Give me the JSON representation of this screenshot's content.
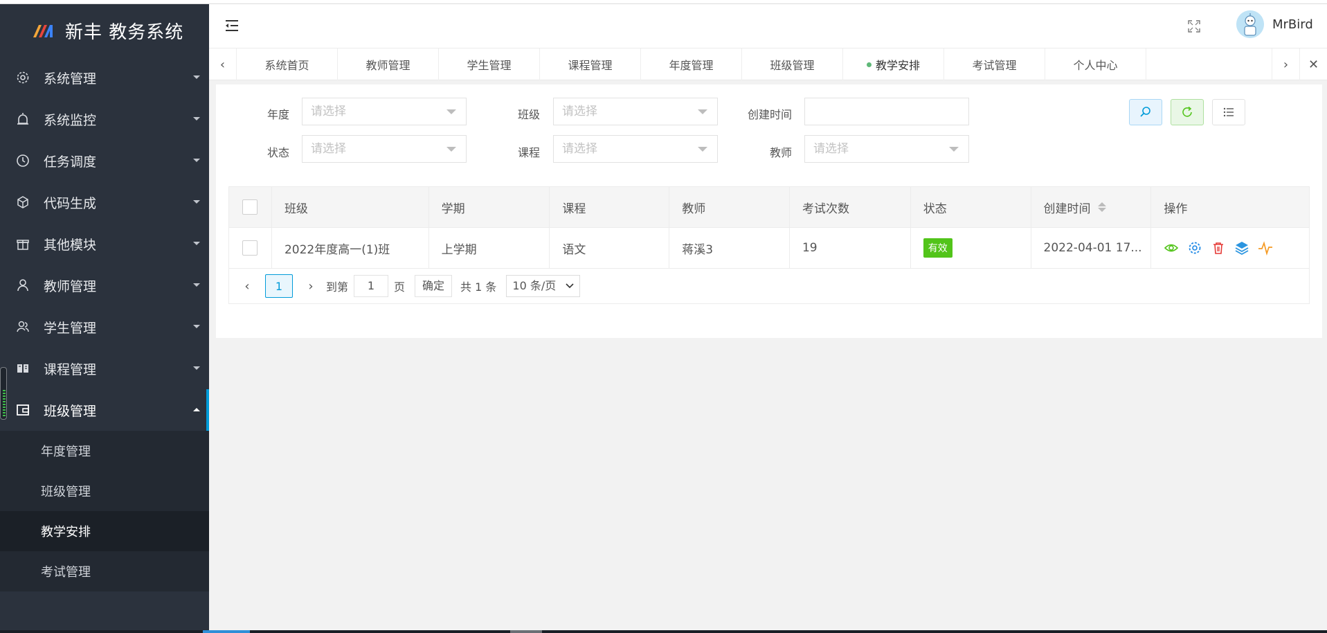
{
  "app": {
    "title": "新丰 教务系统",
    "username": "MrBird"
  },
  "colors": {
    "sidebar_bg": "#2b323d",
    "accent": "#009bd9",
    "status_ok": "#52c41a"
  },
  "sidebar": {
    "items": [
      {
        "label": "系统管理",
        "icon": "gear-icon"
      },
      {
        "label": "系统监控",
        "icon": "alarm-icon"
      },
      {
        "label": "任务调度",
        "icon": "clock-icon"
      },
      {
        "label": "代码生成",
        "icon": "cube-icon"
      },
      {
        "label": "其他模块",
        "icon": "gift-icon"
      },
      {
        "label": "教师管理",
        "icon": "user-icon"
      },
      {
        "label": "学生管理",
        "icon": "users-icon"
      },
      {
        "label": "课程管理",
        "icon": "book-icon"
      },
      {
        "label": "班级管理",
        "icon": "wallet-icon"
      }
    ],
    "subitems": [
      "年度管理",
      "班级管理",
      "教学安排",
      "考试管理"
    ],
    "active_subitem": "教学安排"
  },
  "tabs": [
    "系统首页",
    "教师管理",
    "学生管理",
    "课程管理",
    "年度管理",
    "班级管理",
    "教学安排",
    "考试管理",
    "个人中心"
  ],
  "active_tab": "教学安排",
  "filters": {
    "year_label": "年度",
    "class_label": "班级",
    "created_label": "创建时间",
    "status_label": "状态",
    "course_label": "课程",
    "teacher_label": "教师",
    "placeholder": "请选择"
  },
  "table": {
    "columns": [
      "班级",
      "学期",
      "课程",
      "教师",
      "考试次数",
      "状态",
      "创建时间",
      "操作"
    ],
    "rows": [
      {
        "class": "2022年度高一(1)班",
        "term": "上学期",
        "course": "语文",
        "teacher": "蒋溪3",
        "exams": "19",
        "status": "有效",
        "created": "2022-04-01 17..."
      }
    ]
  },
  "pager": {
    "current": "1",
    "goto_label": "到第",
    "goto_value": "1",
    "page_unit": "页",
    "confirm": "确定",
    "total": "共 1 条",
    "page_size": "10 条/页"
  }
}
